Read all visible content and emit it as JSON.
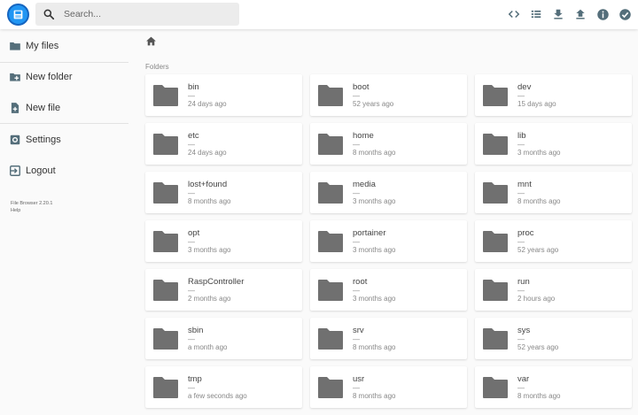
{
  "colors": {
    "accent": "#2196f3",
    "folder": "#707070",
    "icon": "#546e7a"
  },
  "header": {
    "logo_icon": "file-browser-logo",
    "search": {
      "placeholder": "Search...",
      "value": ""
    },
    "tools": [
      "code-switch-icon",
      "list-view-icon",
      "download-icon",
      "upload-icon",
      "info-icon",
      "select-check-icon"
    ]
  },
  "sidebar": {
    "items": [
      {
        "label": "My files",
        "icon": "folder-icon"
      },
      {
        "label": "New folder",
        "icon": "create-folder-icon"
      },
      {
        "label": "New file",
        "icon": "note-add-icon"
      },
      {
        "label": "Settings",
        "icon": "settings-icon"
      },
      {
        "label": "Logout",
        "icon": "logout-icon"
      }
    ],
    "credits": {
      "version": "File Browser 2.20.1",
      "help": "Help"
    }
  },
  "main": {
    "breadcrumb_icon": "home-icon",
    "section_title": "Folders",
    "folders": [
      {
        "name": "bin",
        "size": "—",
        "modified": "24 days ago"
      },
      {
        "name": "boot",
        "size": "—",
        "modified": "52 years ago"
      },
      {
        "name": "dev",
        "size": "—",
        "modified": "15 days ago"
      },
      {
        "name": "etc",
        "size": "—",
        "modified": "24 days ago"
      },
      {
        "name": "home",
        "size": "—",
        "modified": "8 months ago"
      },
      {
        "name": "lib",
        "size": "—",
        "modified": "3 months ago"
      },
      {
        "name": "lost+found",
        "size": "—",
        "modified": "8 months ago"
      },
      {
        "name": "media",
        "size": "—",
        "modified": "3 months ago"
      },
      {
        "name": "mnt",
        "size": "—",
        "modified": "8 months ago"
      },
      {
        "name": "opt",
        "size": "—",
        "modified": "3 months ago"
      },
      {
        "name": "portainer",
        "size": "—",
        "modified": "3 months ago"
      },
      {
        "name": "proc",
        "size": "—",
        "modified": "52 years ago"
      },
      {
        "name": "RaspController",
        "size": "—",
        "modified": "2 months ago"
      },
      {
        "name": "root",
        "size": "—",
        "modified": "3 months ago"
      },
      {
        "name": "run",
        "size": "—",
        "modified": "2 hours ago"
      },
      {
        "name": "sbin",
        "size": "—",
        "modified": "a month ago"
      },
      {
        "name": "srv",
        "size": "—",
        "modified": "8 months ago"
      },
      {
        "name": "sys",
        "size": "—",
        "modified": "52 years ago"
      },
      {
        "name": "tmp",
        "size": "—",
        "modified": "a few seconds ago"
      },
      {
        "name": "usr",
        "size": "—",
        "modified": "8 months ago"
      },
      {
        "name": "var",
        "size": "—",
        "modified": "8 months ago"
      }
    ]
  }
}
